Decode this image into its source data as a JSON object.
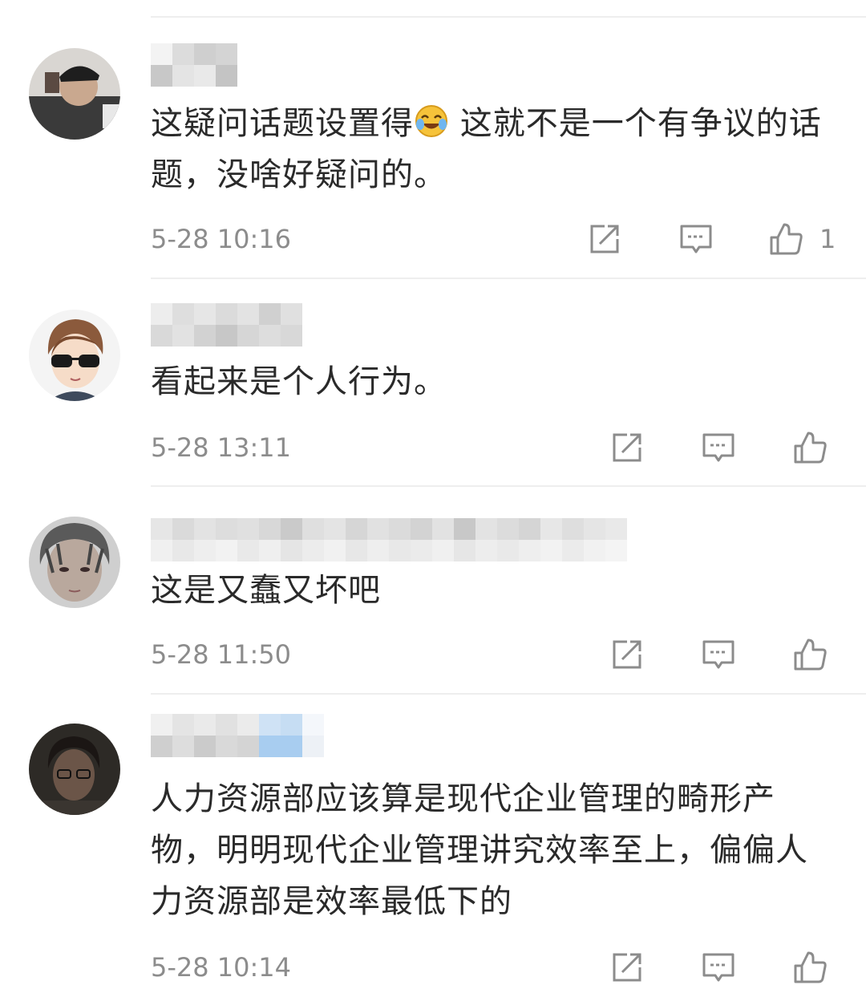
{
  "comments": [
    {
      "text_before_emoji": "这疑问话题设置得",
      "emoji": "laughing-crying-emoji",
      "text_after_emoji": " 这就不是一个有争议的话题，没啥好疑问的。",
      "time": "5-28 10:16",
      "like_count": "1"
    },
    {
      "text": "看起来是个人行为。",
      "time": "5-28 13:11",
      "like_count": ""
    },
    {
      "text": "这是又蠢又坏吧",
      "time": "5-28 11:50",
      "like_count": ""
    },
    {
      "text": "人力资源部应该算是现代企业管理的畸形产物，明明现代企业管理讲究效率至上，偏偏人力资源部是效率最低下的",
      "time": "5-28 10:14",
      "like_count": ""
    }
  ],
  "icons": {
    "share": "share-icon",
    "reply": "comment-icon",
    "like": "thumbs-up-icon"
  },
  "colors": {
    "text": "#2a2a2a",
    "meta": "#8c8c8c",
    "divider": "#eeeeee",
    "blur_blue": "#a8cdf0"
  }
}
